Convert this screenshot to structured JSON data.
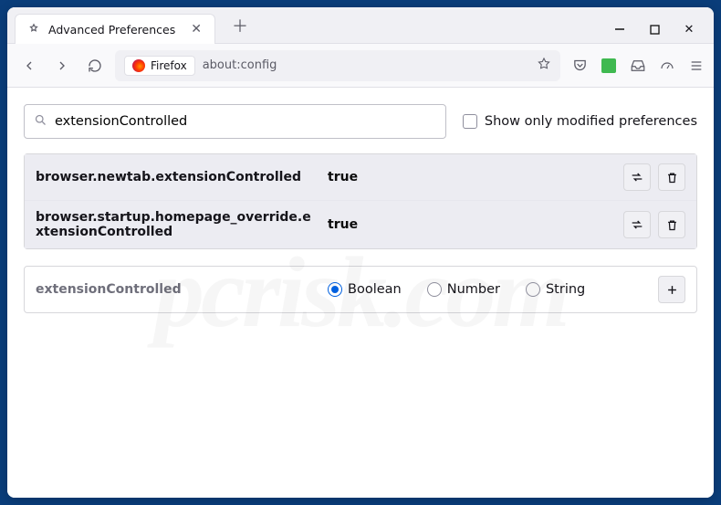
{
  "window": {
    "tab_title": "Advanced Preferences",
    "url_origin": "Firefox",
    "url_path": "about:config"
  },
  "search": {
    "value": "extensionControlled",
    "modified_only_label": "Show only modified preferences"
  },
  "prefs": [
    {
      "name": "browser.newtab.extensionControlled",
      "value": "true"
    },
    {
      "name": "browser.startup.homepage_override.extensionControlled",
      "value": "true"
    }
  ],
  "new_pref": {
    "name": "extensionControlled",
    "type_options": {
      "boolean": "Boolean",
      "number": "Number",
      "string": "String"
    },
    "selected": "boolean"
  }
}
